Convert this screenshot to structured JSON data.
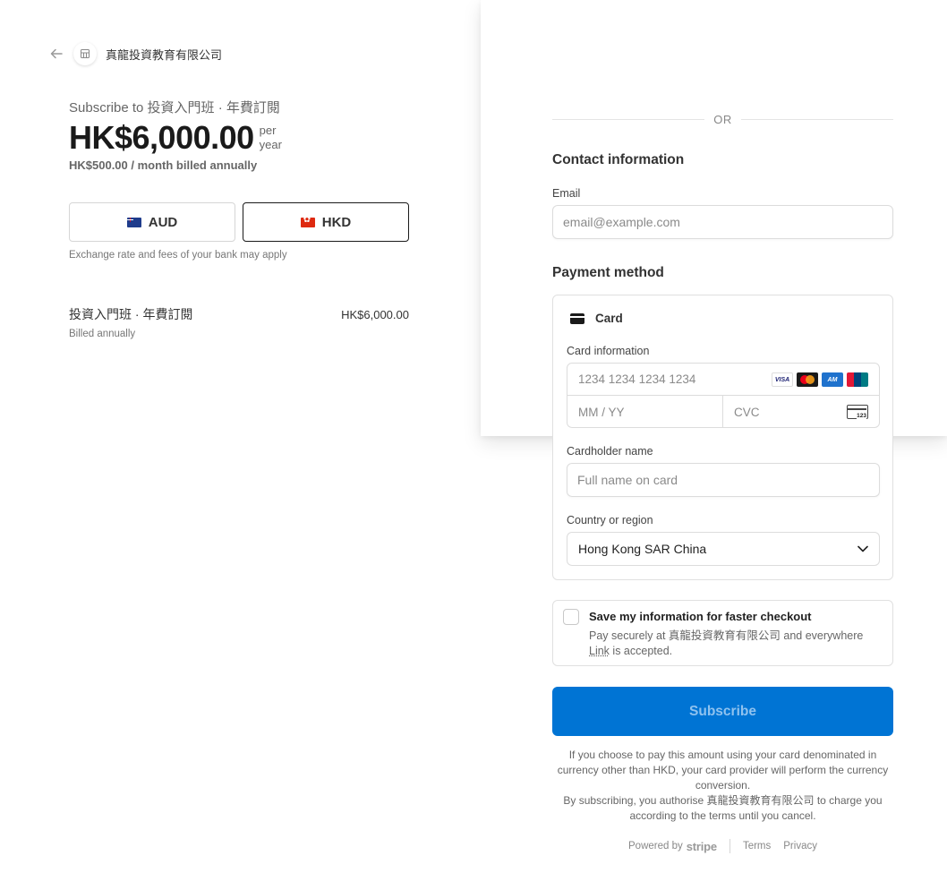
{
  "merchant": {
    "name": "真龍投資教育有限公司"
  },
  "summary": {
    "subscribe_to": "Subscribe to 投資入門班 · 年費訂閱",
    "price": "HK$6,000.00",
    "per_line1": "per",
    "per_line2": "year",
    "monthly": "HK$500.00 / month billed annually",
    "currencies": [
      {
        "code": "AUD",
        "selected": false
      },
      {
        "code": "HKD",
        "selected": true
      }
    ],
    "exchange_note": "Exchange rate and fees of your bank may apply",
    "line_item": {
      "name": "投資入門班 · 年費訂閱",
      "price": "HK$6,000.00",
      "billing": "Billed annually"
    }
  },
  "form": {
    "or": "OR",
    "contact_title": "Contact information",
    "email_label": "Email",
    "email_placeholder": "email@example.com",
    "payment_title": "Payment method",
    "method": "Card",
    "card_info_label": "Card information",
    "card_number_placeholder": "1234 1234 1234 1234",
    "brands": [
      "VISA",
      "Mastercard",
      "American Express",
      "UnionPay"
    ],
    "expiry_placeholder": "MM / YY",
    "cvc_placeholder": "CVC",
    "cardholder_label": "Cardholder name",
    "cardholder_placeholder": "Full name on card",
    "country_label": "Country or region",
    "country_value": "Hong Kong SAR China",
    "save_title": "Save my information for faster checkout",
    "save_desc_1": "Pay securely at 真龍投資教育有限公司 and everywhere ",
    "save_desc_link": "Link",
    "save_desc_2": " is accepted.",
    "subscribe_label": "Subscribe",
    "legal_1": "If you choose to pay this amount using your card denominated in currency other than HKD, your card provider will perform the currency conversion.",
    "legal_2": "By subscribing, you authorise 真龍投資教育有限公司 to charge you according to the terms until you cancel."
  },
  "footer": {
    "powered_by": "Powered by",
    "stripe": "stripe",
    "terms": "Terms",
    "privacy": "Privacy"
  },
  "colors": {
    "primary_button": "#0074d4",
    "primary_button_text": "#8fc2ef"
  }
}
